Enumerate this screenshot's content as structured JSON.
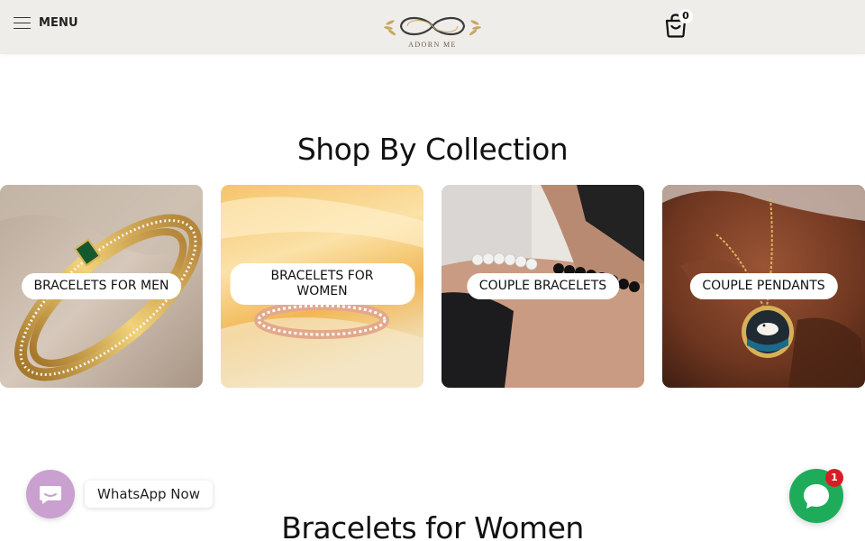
{
  "header": {
    "menu_label": "MENU",
    "logo_text": "ADORN ME",
    "cart_count": "0"
  },
  "collection": {
    "title": "Shop By Collection",
    "cards": [
      {
        "label": "BRACELETS FOR MEN"
      },
      {
        "label_line1": "BRACELETS FOR",
        "label_line2": "WOMEN"
      },
      {
        "label": "COUPLE BRACELETS"
      },
      {
        "label": "COUPLE PENDANTS"
      }
    ]
  },
  "next_section": {
    "title": "Bracelets for Women"
  },
  "whatsapp": {
    "label": "WhatsApp Now"
  },
  "chat": {
    "badge": "1"
  },
  "colors": {
    "header_bg": "#efede9",
    "whatsapp_button": "#c9a0cf",
    "chat_button": "#1eac5b",
    "badge": "#d81d24"
  }
}
